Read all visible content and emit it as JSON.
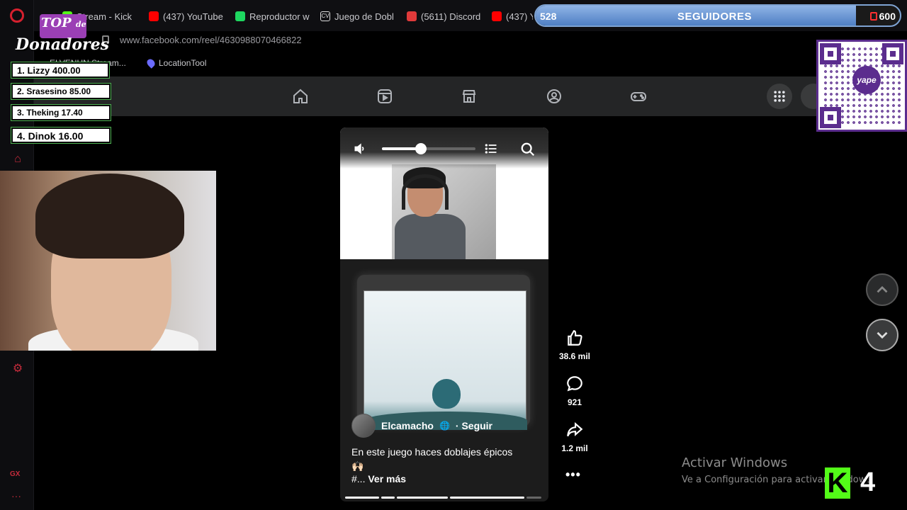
{
  "tabs": [
    {
      "label": "Stream - Kick",
      "icon": "kick-icon"
    },
    {
      "label": "(437) YouTube",
      "icon": "youtube-icon"
    },
    {
      "label": "Reproductor w",
      "icon": "spotify-icon"
    },
    {
      "label": "Juego de Dobl",
      "icon": "cv-icon"
    },
    {
      "label": "(5611) Discord",
      "icon": "discord-icon"
    },
    {
      "label": "(437) Y",
      "icon": "youtube-icon"
    }
  ],
  "address": {
    "url": "www.facebook.com/reel/4630988070466822"
  },
  "bookmarks": [
    {
      "label": "ELVENUN Stream..."
    },
    {
      "label": "LocationTool"
    }
  ],
  "reel": {
    "volume": 0.42,
    "author": "Elcamacho",
    "privacy_icon": "globe-icon",
    "follow_label": "· Seguir",
    "caption": "En este juego haces doblajes épicos",
    "caption_emoji": "🙌🏻",
    "caption_hashtag": "#...",
    "more_label": "Ver más",
    "progress_segments": [
      0.18,
      0.07,
      0.27,
      0.39,
      0.08
    ]
  },
  "actions": {
    "likes": "38.6 mil",
    "comments": "921",
    "shares": "1.2 mil",
    "more": "•••"
  },
  "watermark": {
    "line1": "Activar Windows",
    "line2": "Ve a Configuración para activar Windows."
  },
  "followers": {
    "current": "528",
    "label": "SEGUIDORES",
    "goal": "600",
    "progress": 0.88
  },
  "donors": {
    "logo_top": "TOP",
    "logo_small": "de",
    "logo_script": "Donadores",
    "list": [
      {
        "label": "1. Lizzy 400.00"
      },
      {
        "label": "2. Srasesino 85.00"
      },
      {
        "label": "3. Theking 17.40"
      },
      {
        "label": "4. Dinok 16.00"
      }
    ]
  },
  "qr": {
    "brand": "yape"
  },
  "kick_overlay": {
    "count": "4"
  },
  "colors": {
    "fb_nav": "#242526",
    "follow_bar": "#4f7fc4",
    "opera_red": "#d5202e",
    "kick_green": "#53fc18",
    "yape_purple": "#5b2d8e"
  }
}
